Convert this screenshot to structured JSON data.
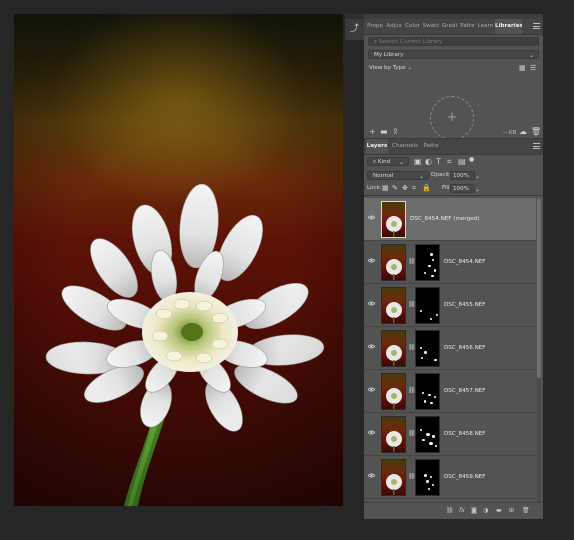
{
  "libraries_panel": {
    "tabs": [
      "Prope",
      "Adjus",
      "Color",
      "Swatc",
      "Gradi",
      "Patte",
      "Learn",
      "Libraries"
    ],
    "active_tab": "Libraries",
    "search_placeholder": "Search Current Library",
    "library_select": "My Library",
    "view_mode": "View by Type",
    "add_icon": "+",
    "storage": "-- KB"
  },
  "layers_panel": {
    "tabs": [
      "Layers",
      "Channels",
      "Paths"
    ],
    "active_tab": "Layers",
    "filter_kind": "Kind",
    "blend_mode": "Normal",
    "opacity_label": "Opacity:",
    "opacity_value": "100%",
    "lock_label": "Lock:",
    "fill_label": "Fill:",
    "fill_value": "100%",
    "layers": [
      {
        "name": "DSC_8454.NEF (merged)",
        "selected": true,
        "has_mask": false
      },
      {
        "name": "DSC_8454.NEF",
        "selected": false,
        "has_mask": true
      },
      {
        "name": "DSC_8455.NEF",
        "selected": false,
        "has_mask": true
      },
      {
        "name": "DSC_8456.NEF",
        "selected": false,
        "has_mask": true
      },
      {
        "name": "DSC_8457.NEF",
        "selected": false,
        "has_mask": true
      },
      {
        "name": "DSC_8458.NEF",
        "selected": false,
        "has_mask": true
      },
      {
        "name": "DSC_8459.NEF",
        "selected": false,
        "has_mask": true
      }
    ],
    "bottom_icons": [
      "link-layers-icon",
      "fx-icon",
      "add-mask-icon",
      "adjustment-layer-icon",
      "group-folder-icon",
      "new-layer-icon",
      "delete-layer-icon"
    ],
    "fx_label": "fx"
  },
  "colors": {
    "panel_bg": "#535353",
    "selected_row": "#6d6d6d",
    "app_bg": "#262626"
  }
}
